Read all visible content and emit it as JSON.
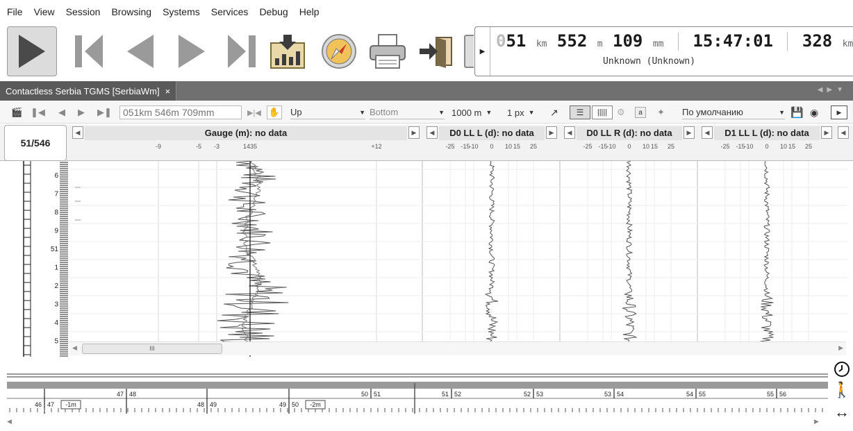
{
  "menu": [
    "File",
    "View",
    "Session",
    "Browsing",
    "Systems",
    "Services",
    "Debug",
    "Help"
  ],
  "info": {
    "km_prefix": "0",
    "km": "51",
    "km_unit": "km",
    "m": "552",
    "m_unit": "m",
    "mm": "109",
    "mm_unit": "mm",
    "time": "15:47:01",
    "speed": "328",
    "speed_unit": "km/h",
    "status": "Unknown (Unknown)"
  },
  "tab": {
    "title": "Contactless Serbia TGMS [SerbiaWm]",
    "close": "×"
  },
  "toolbar2": {
    "position_placeholder": "051km 546m 709mm",
    "direction": "Up",
    "alignment": "Bottom",
    "scale": "1000 m",
    "pixel": "1 px",
    "preset": "По умолчанию"
  },
  "position_badge": "51/546",
  "panels": [
    {
      "title": "Gauge (m): no data",
      "ticks": [
        "-9",
        "-5",
        "-3",
        "1435",
        "+12"
      ]
    },
    {
      "title": "D0 LL L (d): no data",
      "ticks": [
        "-25",
        "-15",
        "-10",
        "0",
        "10",
        "15",
        "25"
      ]
    },
    {
      "title": "D0 LL R (d): no data",
      "ticks": [
        "-25",
        "-15",
        "-10",
        "0",
        "10",
        "15",
        "25"
      ]
    },
    {
      "title": "D1 LL L (d): no data",
      "ticks": [
        "-25",
        "-15",
        "-10",
        "0",
        "10",
        "15",
        "25"
      ]
    }
  ],
  "ruler_labels": [
    "6",
    "7",
    "8",
    "9",
    "51",
    "1",
    "2",
    "3",
    "4",
    "5"
  ],
  "scroll_thumb": "III",
  "km_track": {
    "upper": [
      "47",
      "48",
      "50",
      "51",
      "51",
      "52",
      "52",
      "53",
      "53",
      "54",
      "54",
      "55",
      "55",
      "56"
    ],
    "lower": [
      "46",
      "47",
      "48",
      "49",
      "49",
      "50"
    ],
    "badges": [
      "-1m",
      "-2m"
    ]
  },
  "colors": {
    "tab_bg": "#707070",
    "accent": "#4a4a4a",
    "trace": "#555555"
  }
}
